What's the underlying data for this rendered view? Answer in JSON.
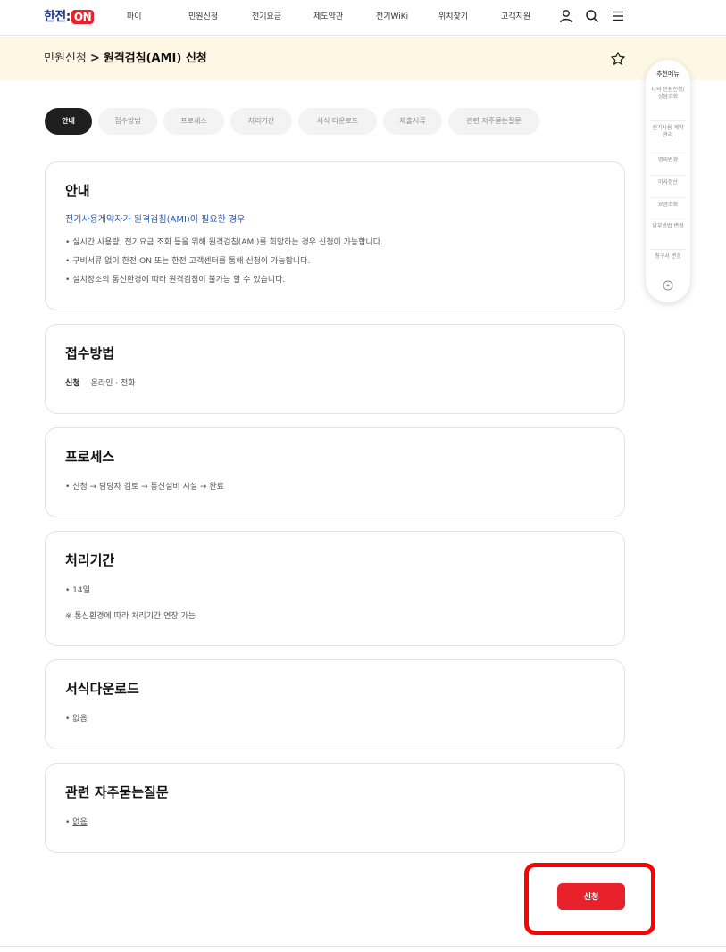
{
  "header": {
    "logo": {
      "part1": "한전",
      "colon": ":",
      "on": "ON"
    },
    "nav": [
      "마이",
      "민원신청",
      "전기요금",
      "제도약관",
      "전기WiKi",
      "위치찾기",
      "고객지원"
    ]
  },
  "breadcrumb": {
    "root": "민원신청",
    "separator": ">",
    "current": "원격검침(AMI) 신청"
  },
  "tabs": [
    {
      "label": "안내",
      "active": true
    },
    {
      "label": "접수방법",
      "active": false
    },
    {
      "label": "프로세스",
      "active": false
    },
    {
      "label": "처리기간",
      "active": false
    },
    {
      "label": "서식 다운로드",
      "active": false
    },
    {
      "label": "제출서류",
      "active": false
    },
    {
      "label": "관련 자주묻는질문",
      "active": false
    }
  ],
  "sections": {
    "guide": {
      "title": "안내",
      "subtitle": "전기사용계약자가 원격검침(AMI)이 필요한 경우",
      "lines": [
        "• 실시간 사용량, 전기요금 조회 등을 위해 원격검침(AMI)를 희망하는 경우 신청이 가능합니다.",
        "• 구비서류 없이 한전:ON 또는 한전 고객센터를 통해 신청이 가능합니다.",
        "• 설치장소의 통신환경에 따라 원격검침이 불가능 할 수 있습니다."
      ]
    },
    "method": {
      "title": "접수방법",
      "label": "신청",
      "value": "온라인 · 전화"
    },
    "process": {
      "title": "프로세스",
      "line": "• 신청 → 담당자 검토 → 통신설비 시설 → 완료"
    },
    "period": {
      "title": "처리기간",
      "line1": "• 14일",
      "line2": "※ 통신환경에 따라 처리기간 연장 가능"
    },
    "download": {
      "title": "서식다운로드",
      "line": "• 없음"
    },
    "faq": {
      "title": "관련 자주묻는질문",
      "bullet": "• ",
      "link": "없음"
    }
  },
  "quick_menu": {
    "title": "추천메뉴",
    "items": [
      "나의 민원신청/ 상담조회",
      "전기사용 계약관리",
      "명의변경",
      "이사정산",
      "요금조회",
      "납부방법 변경",
      "청구서 변경"
    ]
  },
  "apply_button": "신청",
  "colors": {
    "accent": "#e8212b",
    "band": "#fdf7e3",
    "link_blue": "#2a5bb0"
  }
}
